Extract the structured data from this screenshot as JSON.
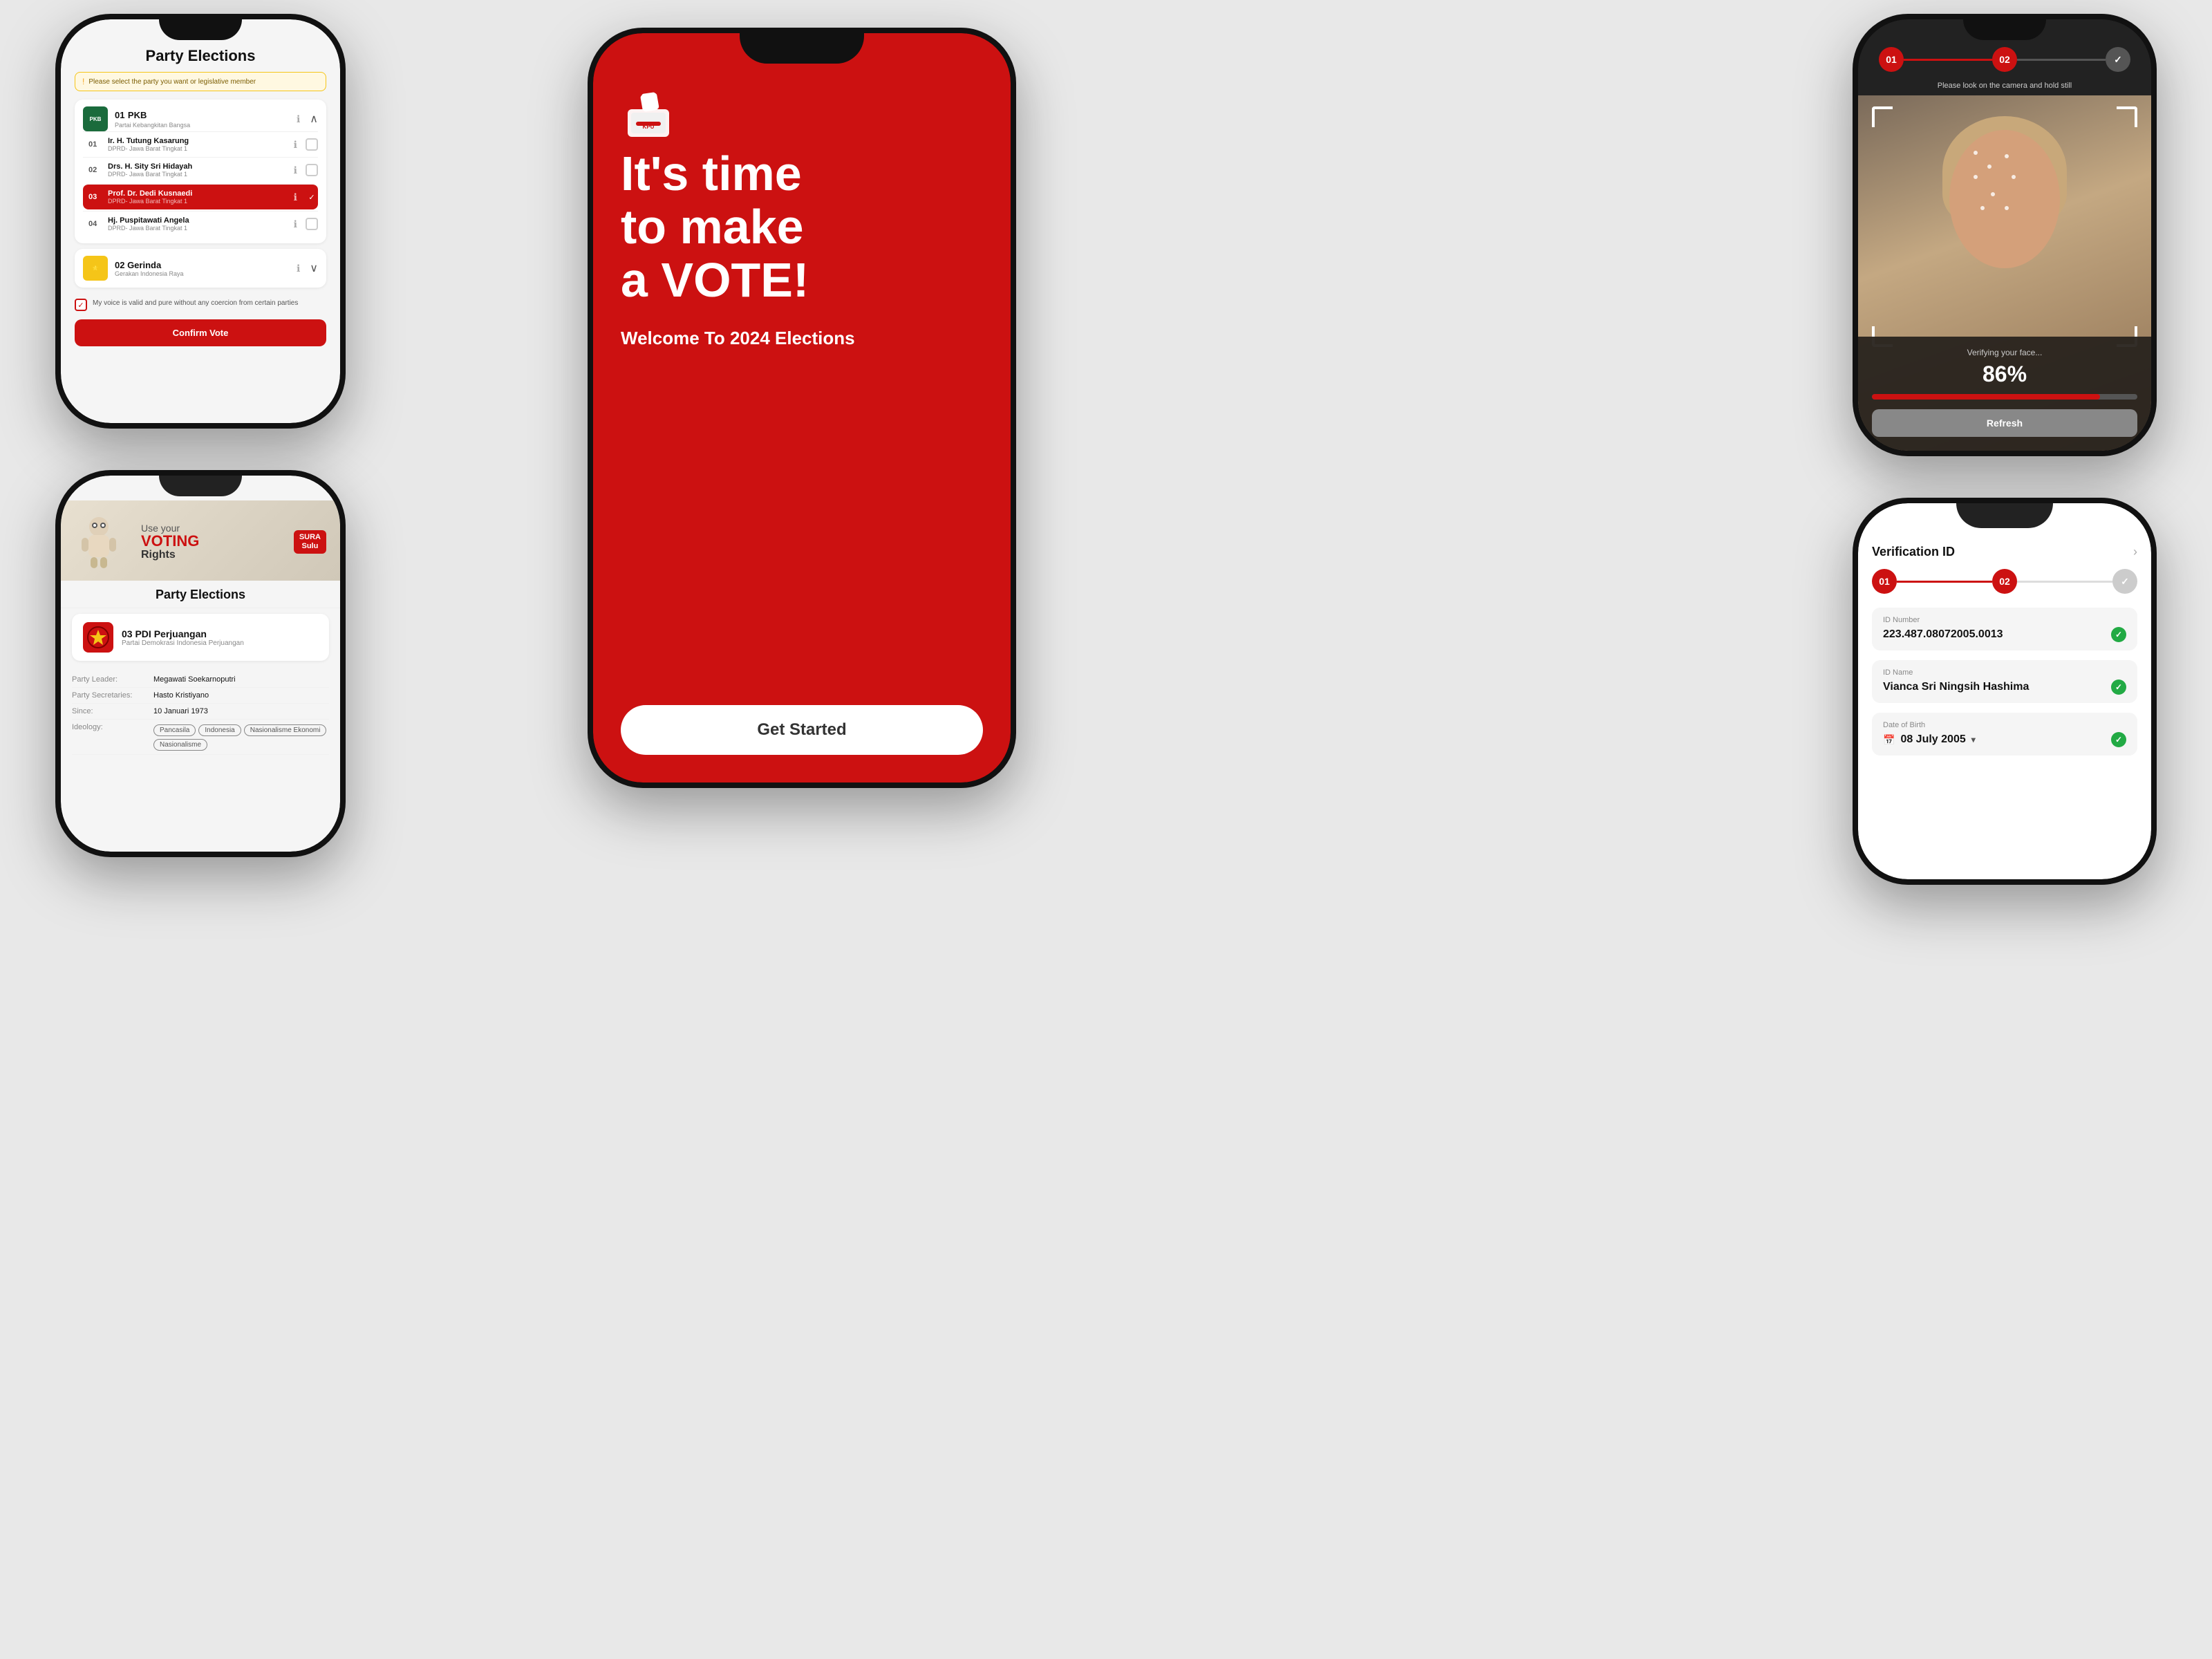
{
  "phone1": {
    "title": "Party Elections",
    "warning": "Please select the party you want or legislative member",
    "party1": {
      "num": "01",
      "name": "PKB",
      "fullname": "Partai Kebangkitan Bangsa",
      "logoText": "PKB",
      "logoColor": "#1a6b3c"
    },
    "candidates": [
      {
        "num": "01",
        "name": "Ir. H. Tutung Kasarung",
        "region": "DPRD- Jawa Barat Tingkat 1",
        "checked": false
      },
      {
        "num": "02",
        "name": "Drs. H. Sity Sri Hidayah",
        "region": "DPRD- Jawa Barat Tingkat 1",
        "checked": false
      },
      {
        "num": "03",
        "name": "Prof. Dr. Dedi Kusnaedi",
        "region": "DPRD- Jawa Barat Tingkat 1",
        "checked": true,
        "selected": true
      },
      {
        "num": "04",
        "name": "Hj. Puspitawati Angela",
        "region": "DPRD- Jawa Barat Tingkat 1",
        "checked": false
      }
    ],
    "party2": {
      "num": "02",
      "name": "Gerinda",
      "fullname": "Gerakan Indonesia Raya",
      "logoColor": "#f5c518"
    },
    "consent": "My voice is valid and pure without any coercion from certain parties",
    "confirmBtn": "Confirm Vote"
  },
  "phone2": {
    "hero1": "It's time",
    "hero2": "to make",
    "hero3": "a VOTE!",
    "welcome": "Welcome To",
    "year": "2024 Elections",
    "getStarted": "Get Started"
  },
  "phone3": {
    "step1": "01",
    "step2": "02",
    "stepDone": "✓",
    "hint": "Please look on the camera and hold still",
    "verifying": "Verifying your face...",
    "percent": "86%",
    "progressPct": 86,
    "refreshBtn": "Refresh"
  },
  "phone4": {
    "banner": {
      "useYour": "Use your",
      "voting": "VOTING",
      "rights": "Rights",
      "sura": "SURA",
      "sulu": "Sulu"
    },
    "partyDetailTitle": "Party Elections",
    "party": {
      "num": "03",
      "name": "PDI Perjuangan",
      "fullname": "Partai Demokrasi Indonesia Perjuangan"
    },
    "details": [
      {
        "label": "Party Leader:",
        "value": "Megawati Soekarnoputri"
      },
      {
        "label": "Party Secretaries:",
        "value": "Hasto Kristiyano"
      },
      {
        "label": "Since:",
        "value": "10 Januari 1973"
      },
      {
        "label": "Ideology:",
        "value": ""
      }
    ],
    "ideologyTags": [
      "Pancasila",
      "Indonesia",
      "Nasionalisme Ekonomi",
      "Nasionalisme"
    ]
  },
  "phone5": {
    "title": "Verification ID",
    "step1": "01",
    "step2": "02",
    "stepDone": "✓",
    "fields": [
      {
        "label": "ID Number",
        "value": "223.487.08072005.0013"
      },
      {
        "label": "ID Name",
        "value": "Vianca Sri Ningsih Hashima"
      },
      {
        "label": "Date of Birth",
        "value": "08 July 2005"
      }
    ]
  }
}
